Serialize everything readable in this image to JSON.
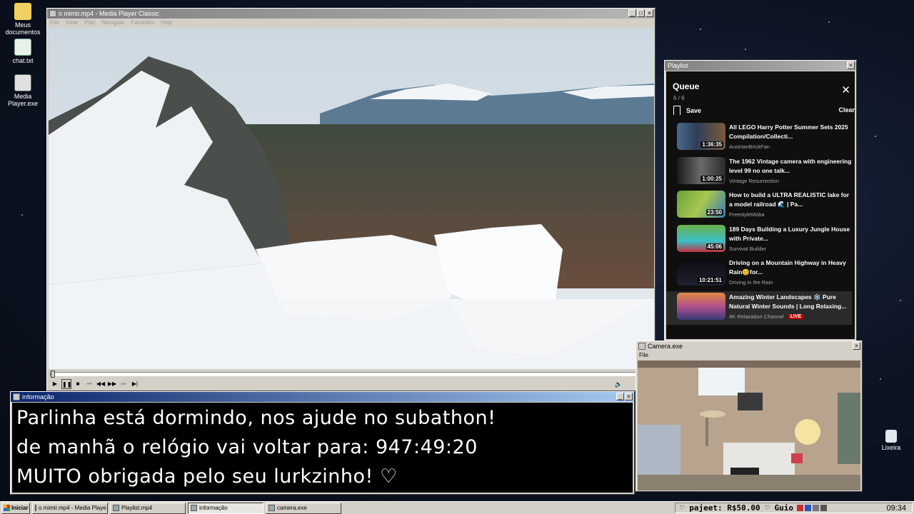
{
  "desktop": {
    "icons": [
      {
        "label": "Meus documentos",
        "icon": "folder-icon"
      },
      {
        "label": "chat.txt",
        "icon": "text-file-icon"
      },
      {
        "label": "Media Player.exe",
        "icon": "media-player-icon"
      },
      {
        "label": "Lixeira",
        "icon": "recycle-bin-icon"
      }
    ]
  },
  "media_player": {
    "title": "o mimir.mp4 - Media Player Classic",
    "menu": [
      "File",
      "View",
      "Play",
      "Navigate",
      "Favorites",
      "Help"
    ],
    "seek_progress": 0.0
  },
  "playlist": {
    "window_title": "Playlist",
    "heading": "Queue",
    "count": "6 / 6",
    "save_label": "Save",
    "clear_label": "Clear",
    "items": [
      {
        "title": "All LEGO Harry Potter Summer Sets 2025 Compilation/Collecti...",
        "channel": "AustrianBrickFan",
        "duration": "1:36:35"
      },
      {
        "title": "The 1962 Vintage camera with engineering level 99 no one talk...",
        "channel": "Vintage Resurrection",
        "duration": "1:00:25"
      },
      {
        "title": "How to build a ULTRA REALISTIC lake for a model railroad 🌊 | Pa...",
        "channel": "FreestyleMoba",
        "duration": "23:50"
      },
      {
        "title": "189 Days Building a Luxury Jungle House with Private...",
        "channel": "Survival Builder",
        "duration": "45:06"
      },
      {
        "title": "Driving on a Mountain Highway in Heavy Rain😊for...",
        "channel": "Driving in the Rain",
        "duration": "10:21:51"
      },
      {
        "title": "Amazing Winter Landscapes ❄️ Pure Natural Winter Sounds | Long Relaxing...",
        "channel": "4K Relaxation Channel",
        "duration": "",
        "live": "LIVE"
      }
    ]
  },
  "info_window": {
    "title": "informação",
    "lines": [
      "Parlinha está dormindo, nos ajude no subathon!",
      "de manhã o relógio vai voltar para:  947:49:20",
      "MUITO obrigada pelo seu lurkzinho! ♡"
    ]
  },
  "camera_window": {
    "title": "Camera.exe",
    "menu": "File"
  },
  "taskbar": {
    "start_label": "Iniciar",
    "tasks": [
      "o mimir.mp4 - Media Playe...",
      "Playlist.mp4",
      "informação",
      "camera.exe"
    ],
    "tray_text": "♡ pajeet: R$50.00 ♡ Guio",
    "clock": "09:34"
  }
}
